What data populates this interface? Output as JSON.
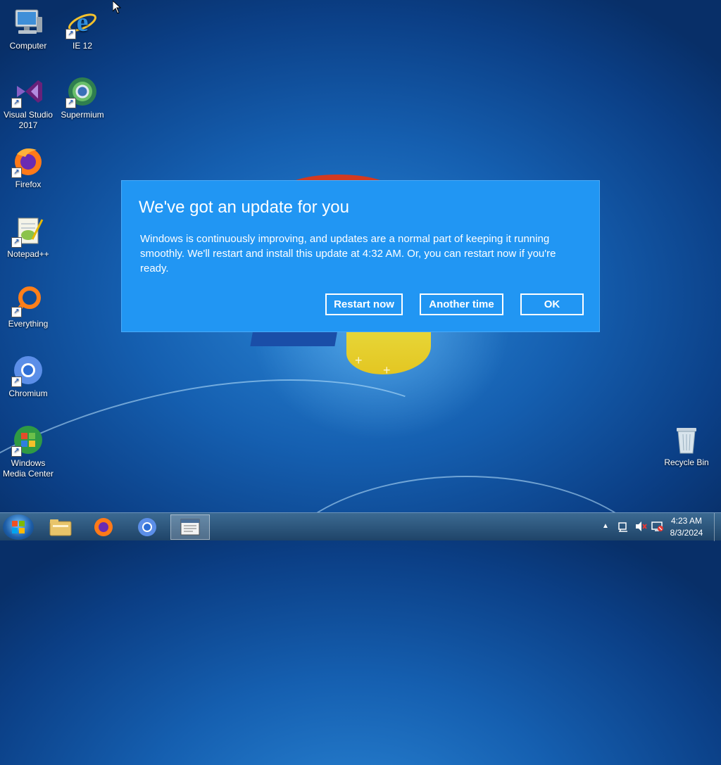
{
  "desktop": {
    "icons": [
      {
        "label": "Computer",
        "icon": "computer-icon"
      },
      {
        "label": "IE 12",
        "icon": "internet-explorer-icon"
      },
      {
        "label": "Visual Studio 2017",
        "icon": "visual-studio-icon"
      },
      {
        "label": "Supermium",
        "icon": "supermium-icon"
      },
      {
        "label": "Firefox",
        "icon": "firefox-icon"
      },
      {
        "label": "Notepad++",
        "icon": "notepadpp-icon"
      },
      {
        "label": "Everything",
        "icon": "everything-icon"
      },
      {
        "label": "Chromium",
        "icon": "chromium-icon"
      },
      {
        "label": "Windows Media Center",
        "icon": "windows-media-center-icon"
      },
      {
        "label": "Recycle Bin",
        "icon": "recycle-bin-icon"
      }
    ]
  },
  "dialog": {
    "title": "We've got an update for you",
    "body": "Windows is continuously improving, and updates are a normal part of keeping it running smoothly. We'll restart and install this update at 4:32 AM. Or, you can restart now if you're ready.",
    "buttons": {
      "restart_now": "Restart now",
      "another_time": "Another time",
      "ok": "OK"
    },
    "background_color": "#2196f3"
  },
  "taskbar": {
    "pinned": [
      "file-explorer-icon",
      "firefox-icon",
      "chromium-icon",
      "notepad-window-icon"
    ],
    "tray": {
      "time": "4:23 AM",
      "date": "8/3/2024"
    }
  }
}
